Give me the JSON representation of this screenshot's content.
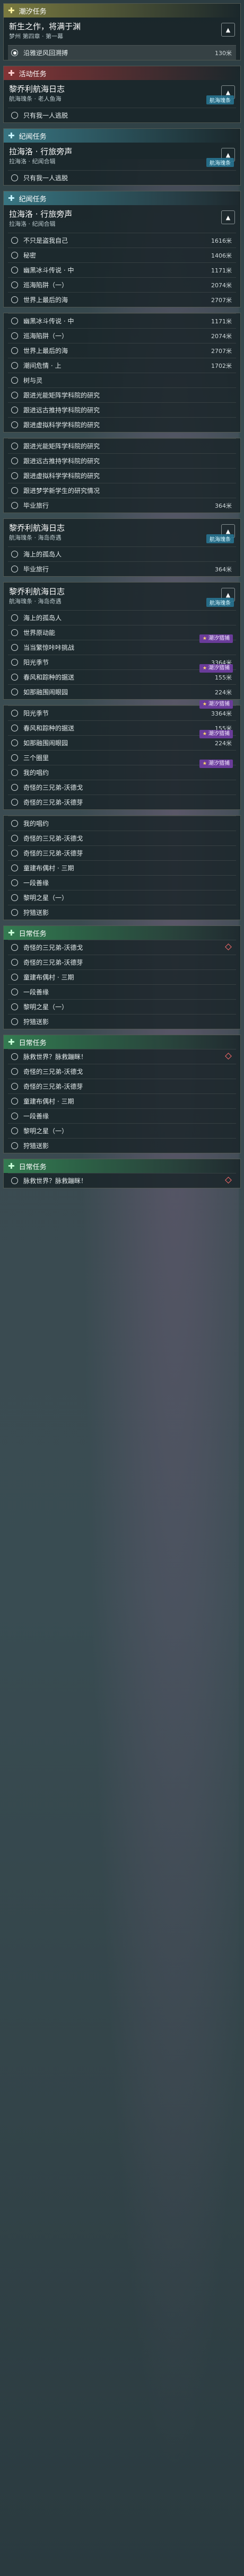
{
  "sections": [
    {
      "category": "潮汐任务",
      "cat_icon": "✚",
      "color": "y",
      "quest": {
        "title": "新生之作，将满于渊",
        "subtitle": "梦州 第四章 · 第一幕",
        "badge": ""
      },
      "rows": [
        {
          "label": "沿雅逆风回溯搏",
          "distance": "130米",
          "tag": "",
          "selected": true
        }
      ]
    },
    {
      "category": "活动任务",
      "cat_icon": "✚",
      "color": "r",
      "quest": {
        "title": "黎乔利航海日志",
        "subtitle": "航海瑰条 · 老人鱼海",
        "badge": "航海瑰条"
      },
      "rows": [
        {
          "label": "只有我一人逃脱",
          "distance": "",
          "tag": "",
          "selected": false
        }
      ]
    },
    {
      "category": "纪闻任务",
      "cat_icon": "✚",
      "color": "c",
      "quest": {
        "title": "拉海洛 · 行旅旁声",
        "subtitle": "拉海洛 · 纪闻合辑",
        "badge": "航海瑰条"
      },
      "rows": [
        {
          "label": "只有我一人逃脱",
          "distance": "",
          "tag": "",
          "selected": false
        }
      ]
    },
    {
      "category": "纪闻任务",
      "cat_icon": "✚",
      "color": "c",
      "quest": {
        "title": "拉海洛 · 行旅旁声",
        "subtitle": "拉海洛 · 纪闻合辑",
        "badge": ""
      },
      "rows": [
        {
          "label": "不只是盗我自己",
          "distance": "1616米",
          "tag": "",
          "selected": false
        },
        {
          "label": "秘密",
          "distance": "1406米",
          "tag": "",
          "selected": false
        },
        {
          "label": "幽黑冰斗传说 · 中",
          "distance": "1171米",
          "tag": "",
          "selected": false
        },
        {
          "label": "巡海陷阱（一）",
          "distance": "2074米",
          "tag": "",
          "selected": false
        },
        {
          "label": "世界上最后的海",
          "distance": "2707米",
          "tag": "",
          "selected": false
        }
      ]
    },
    {
      "category": "",
      "cat_icon": "",
      "color": "",
      "quest": null,
      "rows": [
        {
          "label": "幽黑冰斗传说 · 中",
          "distance": "1171米",
          "tag": "",
          "selected": false
        },
        {
          "label": "巡海陷阱（一）",
          "distance": "2074米",
          "tag": "",
          "selected": false
        },
        {
          "label": "世界上最后的海",
          "distance": "2707米",
          "tag": "",
          "selected": false
        },
        {
          "label": "潮间危情 · 上",
          "distance": "1702米",
          "tag": "",
          "selected": false
        },
        {
          "label": "树与灵",
          "distance": "",
          "tag": "",
          "selected": false
        },
        {
          "label": "跟进光能矩阵学科院的研究",
          "distance": "",
          "tag": "",
          "selected": false
        },
        {
          "label": "跟进远古推持学科院的研究",
          "distance": "",
          "tag": "",
          "selected": false
        },
        {
          "label": "跟进虚拟科学学科院的研究",
          "distance": "",
          "tag": "",
          "selected": false
        }
      ]
    },
    {
      "category": "",
      "cat_icon": "",
      "color": "",
      "quest": null,
      "rows": [
        {
          "label": "跟进光能矩阵学科院的研究",
          "distance": "",
          "tag": "",
          "selected": false
        },
        {
          "label": "跟进远古推持学科院的研究",
          "distance": "",
          "tag": "",
          "selected": false
        },
        {
          "label": "跟进虚拟科学学科院的研究",
          "distance": "",
          "tag": "",
          "selected": false
        },
        {
          "label": "跟进梦学新学生的研究情况",
          "distance": "",
          "tag": "",
          "selected": false
        },
        {
          "label": "毕业旅行",
          "distance": "364米",
          "tag": "",
          "selected": false
        }
      ]
    },
    {
      "category": "",
      "cat_icon": "",
      "color": "",
      "quest": {
        "title": "黎乔利航海日志",
        "subtitle": "航海瑰条 · 海岛奇遇",
        "badge": "航海瑰条"
      },
      "rows": [
        {
          "label": "海上的孤岛人",
          "distance": "",
          "tag": "",
          "selected": false
        },
        {
          "label": "毕业旅行",
          "distance": "364米",
          "tag": "",
          "selected": false
        }
      ]
    },
    {
      "category": "",
      "cat_icon": "",
      "color": "",
      "quest": {
        "title": "黎乔利航海日志",
        "subtitle": "航海瑰条 · 海岛奇遇",
        "badge": "航海瑰条"
      },
      "rows": [
        {
          "label": "海上的孤岛人",
          "distance": "",
          "tag": "",
          "selected": false
        },
        {
          "label": "世界原动能",
          "distance": "",
          "tag": "",
          "selected": false
        },
        {
          "label": "当当繁惊咔咔挑战",
          "distance": "",
          "tag": "潮汐猎捕",
          "selected": false
        },
        {
          "label": "阳光季节",
          "distance": "3364米",
          "tag": "",
          "selected": false
        },
        {
          "label": "春风和踪种的据送",
          "distance": "155米",
          "tag": "潮汐猎捕",
          "selected": false
        },
        {
          "label": "如那融围闹眼园",
          "distance": "224米",
          "tag": "",
          "selected": false
        }
      ]
    },
    {
      "category": "",
      "cat_icon": "",
      "color": "",
      "quest": null,
      "rows": [
        {
          "label": "阳光季节",
          "distance": "3364米",
          "tag": "潮汐猎捕",
          "selected": false
        },
        {
          "label": "春风和踪种的据送",
          "distance": "155米",
          "tag": "",
          "selected": false
        },
        {
          "label": "如那融围闹眼园",
          "distance": "224米",
          "tag": "潮汐猎捕",
          "selected": false
        },
        {
          "label": "三个圈里",
          "distance": "",
          "tag": "",
          "selected": false
        },
        {
          "label": "我的唱约",
          "distance": "",
          "tag": "潮汐猎捕",
          "selected": false
        },
        {
          "label": "奇怪的三兄弟-沃德戈",
          "distance": "",
          "tag": "",
          "selected": false
        },
        {
          "label": "奇怪的三兄弟-沃德芽",
          "distance": "",
          "tag": "",
          "selected": false
        }
      ]
    },
    {
      "category": "",
      "cat_icon": "",
      "color": "",
      "quest": null,
      "rows": [
        {
          "label": "我的唱约",
          "distance": "",
          "tag": "",
          "selected": false
        },
        {
          "label": "奇怪的三兄弟-沃德戈",
          "distance": "",
          "tag": "",
          "selected": false
        },
        {
          "label": "奇怪的三兄弟-沃德芽",
          "distance": "",
          "tag": "",
          "selected": false
        },
        {
          "label": "童建布偶村 · 三期",
          "distance": "",
          "tag": "",
          "selected": false
        },
        {
          "label": "一段善缘",
          "distance": "",
          "tag": "",
          "selected": false
        },
        {
          "label": "黎明之星（一）",
          "distance": "",
          "tag": "",
          "selected": false
        },
        {
          "label": "狩猎送影",
          "distance": "",
          "tag": "",
          "selected": false
        }
      ]
    },
    {
      "category": "日常任务",
      "cat_icon": "✚",
      "color": "g",
      "quest": null,
      "rows": [
        {
          "label": "奇怪的三兄弟-沃德戈",
          "distance": "",
          "tag": "",
          "selected": false
        },
        {
          "label": "奇怪的三兄弟-沃德芽",
          "distance": "",
          "tag": "",
          "selected": false
        },
        {
          "label": "童建布偶村 · 三期",
          "distance": "",
          "tag": "",
          "selected": false
        },
        {
          "label": "一段善缘",
          "distance": "",
          "tag": "",
          "selected": false
        },
        {
          "label": "黎明之星（一）",
          "distance": "",
          "tag": "",
          "selected": false
        },
        {
          "label": "狩猎送影",
          "distance": "",
          "tag": "",
          "selected": false
        }
      ]
    },
    {
      "category": "日常任务",
      "cat_icon": "✚",
      "color": "g",
      "quest": null,
      "rows": [
        {
          "label": "脉救世界？脉救蹦眯！",
          "distance": "",
          "tag": "",
          "selected": false
        },
        {
          "label": "奇怪的三兄弟-沃德戈",
          "distance": "",
          "tag": "",
          "selected": false
        },
        {
          "label": "奇怪的三兄弟-沃德芽",
          "distance": "",
          "tag": "",
          "selected": false
        },
        {
          "label": "童建布偶村 · 三期",
          "distance": "",
          "tag": "",
          "selected": false
        },
        {
          "label": "一段善缘",
          "distance": "",
          "tag": "",
          "selected": false
        },
        {
          "label": "黎明之星（一）",
          "distance": "",
          "tag": "",
          "selected": false
        },
        {
          "label": "狩猎送影",
          "distance": "",
          "tag": "",
          "selected": false
        }
      ]
    },
    {
      "category": "日常任务",
      "cat_icon": "✚",
      "color": "g",
      "quest": null,
      "rows": [
        {
          "label": "脉救世界？脉救蹦眯！",
          "distance": "",
          "tag": "",
          "selected": false
        }
      ]
    }
  ]
}
